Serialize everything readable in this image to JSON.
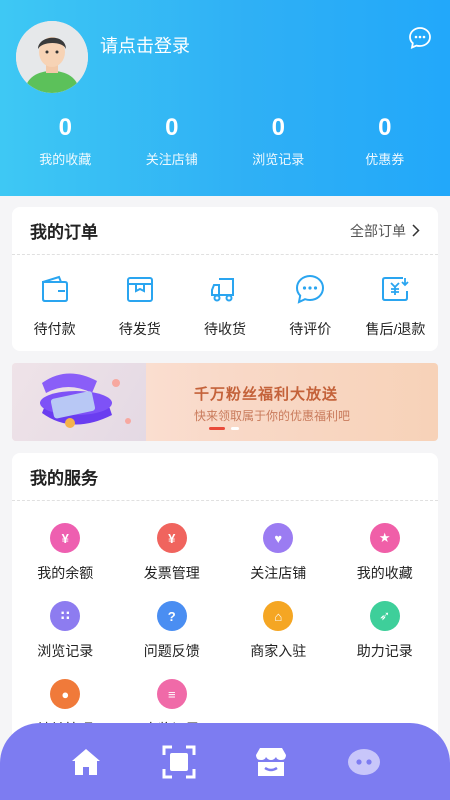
{
  "header": {
    "login_text": "请点击登录",
    "stats": [
      {
        "value": "0",
        "label": "我的收藏"
      },
      {
        "value": "0",
        "label": "关注店铺"
      },
      {
        "value": "0",
        "label": "浏览记录"
      },
      {
        "value": "0",
        "label": "优惠券"
      }
    ],
    "colors": {
      "gradient_start": "#3ec8f4",
      "gradient_end": "#22a8fa"
    }
  },
  "orders": {
    "title": "我的订单",
    "all_label": "全部订单",
    "items": [
      {
        "label": "待付款",
        "icon": "wallet-icon"
      },
      {
        "label": "待发货",
        "icon": "package-icon"
      },
      {
        "label": "待收货",
        "icon": "truck-icon"
      },
      {
        "label": "待评价",
        "icon": "comment-icon"
      },
      {
        "label": "售后/退款",
        "icon": "refund-icon"
      }
    ]
  },
  "banner": {
    "title": "千万粉丝福利大放送",
    "subtitle": "快来领取属于你的优惠福利吧"
  },
  "services": {
    "title": "我的服务",
    "items": [
      {
        "label": "我的余额",
        "icon": "money-bag-icon",
        "color": "#ee5fb0",
        "glyph": "¥"
      },
      {
        "label": "发票管理",
        "icon": "invoice-icon",
        "color": "#f0645e",
        "glyph": "¥"
      },
      {
        "label": "关注店铺",
        "icon": "heart-icon",
        "color": "#9b7cf2",
        "glyph": "♥"
      },
      {
        "label": "我的收藏",
        "icon": "star-icon",
        "color": "#f05fa8",
        "glyph": "★"
      },
      {
        "label": "浏览记录",
        "icon": "footprint-icon",
        "color": "#8d7cf0",
        "glyph": "∷"
      },
      {
        "label": "问题反馈",
        "icon": "question-icon",
        "color": "#4a8ef2",
        "glyph": "?"
      },
      {
        "label": "商家入驻",
        "icon": "shop-icon",
        "color": "#f5a623",
        "glyph": "⌂"
      },
      {
        "label": "助力记录",
        "icon": "rocket-icon",
        "color": "#3ecf9a",
        "glyph": "➶"
      },
      {
        "label": "地址管理",
        "icon": "location-icon",
        "color": "#f07a3a",
        "glyph": "●"
      },
      {
        "label": "大奖记录",
        "icon": "record-icon",
        "color": "#f06aa8",
        "glyph": "≡"
      }
    ]
  },
  "tabbar": {
    "color": "#7d7cf1",
    "tabs": [
      {
        "icon": "home-icon"
      },
      {
        "icon": "scan-icon"
      },
      {
        "icon": "shop-icon"
      },
      {
        "icon": "chat-icon"
      }
    ]
  }
}
